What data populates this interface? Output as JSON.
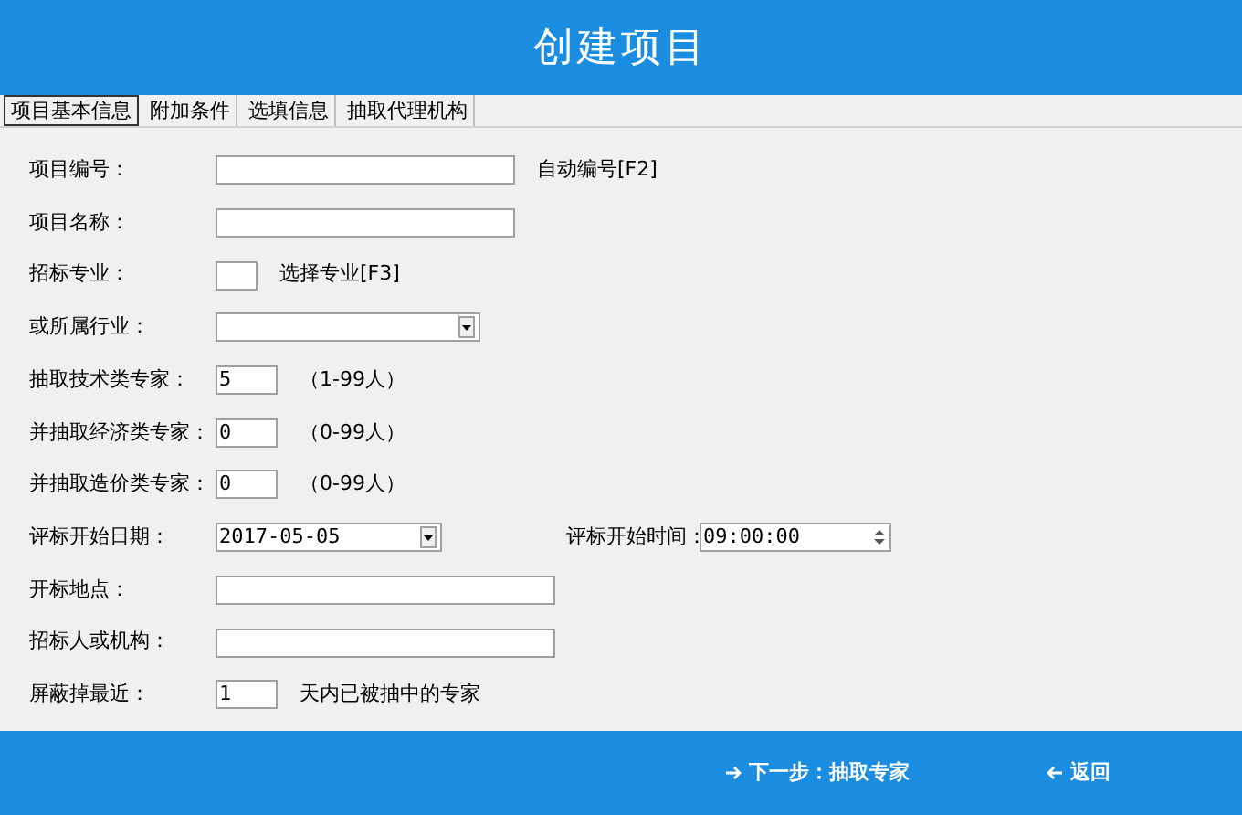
{
  "window": {
    "title": "创建项目"
  },
  "tabs": [
    {
      "label": "项目基本信息",
      "selected": true
    },
    {
      "label": "附加条件",
      "selected": false
    },
    {
      "label": "选填信息",
      "selected": false
    },
    {
      "label": "抽取代理机构",
      "selected": false
    }
  ],
  "rows": [
    {
      "label": "项目编号：",
      "field": {
        "kind": "text"
      },
      "note": "自动编号[F2]"
    },
    {
      "label": "项目名称：",
      "field": {
        "kind": "text"
      }
    },
    {
      "label": "招标专业：",
      "field": {
        "kind": "box"
      },
      "note": "选择专业[F3]"
    },
    {
      "label": "或所属行业：",
      "field": {
        "kind": "select"
      }
    },
    {
      "label": "抽取技术类专家：",
      "field": {
        "kind": "count",
        "value": "5"
      },
      "note": "（1-99人）"
    },
    {
      "label": "并抽取经济类专家：",
      "field": {
        "kind": "count",
        "value": "0"
      },
      "note": "（0-99人）"
    },
    {
      "label": "并抽取造价类专家：",
      "field": {
        "kind": "count",
        "value": "0"
      },
      "note": "（0-99人）"
    },
    {
      "label": "评标开始日期：",
      "field": {
        "kind": "date",
        "value": "2017-05-05"
      },
      "extra": {
        "label": "评标开始时间：",
        "field": {
          "kind": "time",
          "value": "09:00:00"
        }
      }
    },
    {
      "label": "开标地点：",
      "field": {
        "kind": "wide"
      }
    },
    {
      "label": "招标人或机构：",
      "field": {
        "kind": "wide"
      }
    },
    {
      "label": "屏蔽掉最近：",
      "field": {
        "kind": "count",
        "value": "1"
      },
      "note": "天内已被抽中的专家"
    }
  ],
  "footer": {
    "buttons": [
      {
        "kind": "next",
        "label": "下一步：抽取专家"
      },
      {
        "kind": "back",
        "label": "返回"
      }
    ]
  }
}
